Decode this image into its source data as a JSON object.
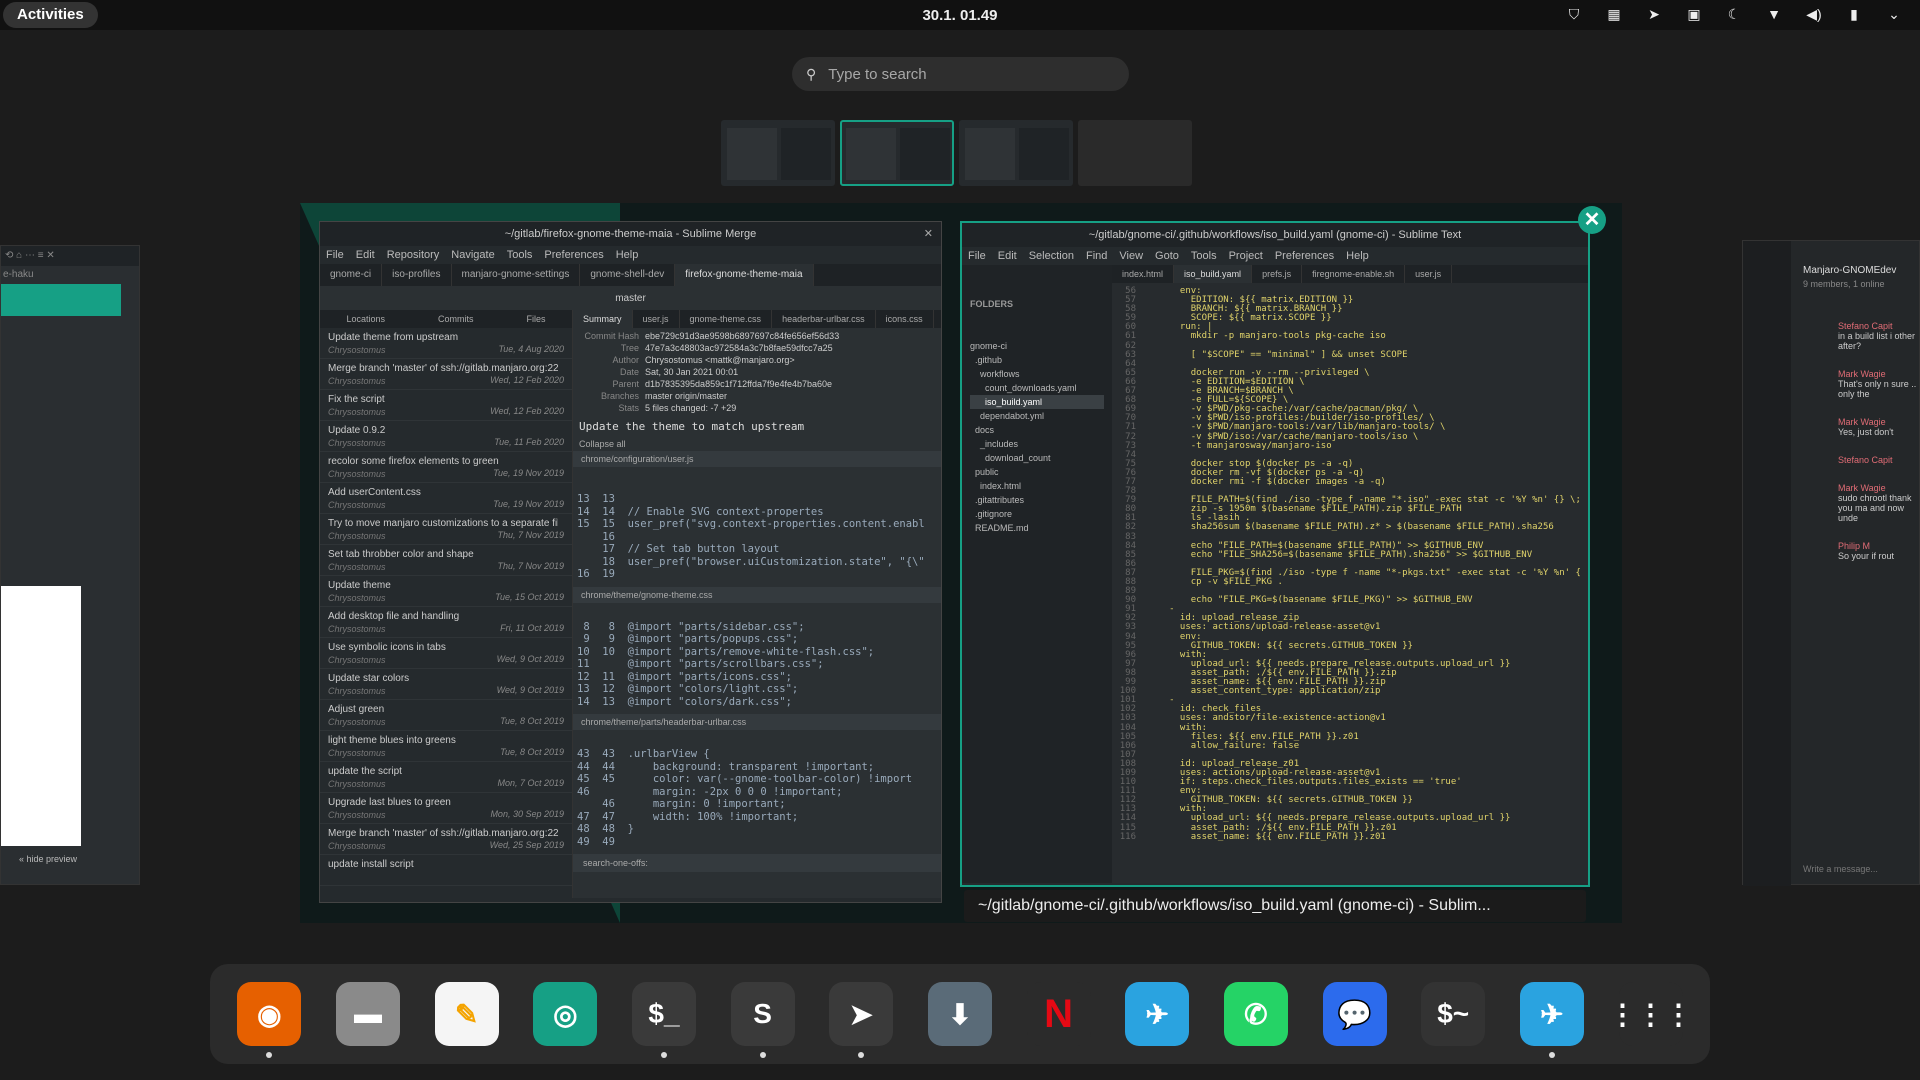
{
  "topbar": {
    "activities": "Activities",
    "clock": "30.1.  01.49"
  },
  "search": {
    "placeholder": "Type to search"
  },
  "merge": {
    "title": "~/gitlab/firefox-gnome-theme-maia - Sublime Merge",
    "menu": [
      "File",
      "Edit",
      "Repository",
      "Navigate",
      "Tools",
      "Preferences",
      "Help"
    ],
    "tabs": [
      "gnome-ci",
      "iso-profiles",
      "manjaro-gnome-settings",
      "gnome-shell-dev",
      "firefox-gnome-theme-maia"
    ],
    "branch": "master",
    "sidetabs": [
      "Locations",
      "Commits",
      "Files"
    ],
    "commits": [
      {
        "s": "Update theme from upstream",
        "a": "Chrysostomus",
        "d": "Tue, 4 Aug 2020"
      },
      {
        "s": "Merge branch 'master' of ssh://gitlab.manjaro.org:22277/",
        "a": "Chrysostomus",
        "d": "Wed, 12 Feb 2020"
      },
      {
        "s": "Fix the script",
        "a": "Chrysostomus",
        "d": "Wed, 12 Feb 2020"
      },
      {
        "s": "Update 0.9.2",
        "a": "Chrysostomus",
        "d": "Tue, 11 Feb 2020"
      },
      {
        "s": "recolor some firefox elements to green",
        "a": "Chrysostomus",
        "d": "Tue, 19 Nov 2019"
      },
      {
        "s": "Add userContent.css",
        "a": "Chrysostomus",
        "d": "Tue, 19 Nov 2019"
      },
      {
        "s": "Try to move manjaro customizations to a separate file",
        "a": "Chrysostomus",
        "d": "Thu, 7 Nov 2019"
      },
      {
        "s": "Set tab throbber color and shape",
        "a": "Chrysostomus",
        "d": "Thu, 7 Nov 2019"
      },
      {
        "s": "Update theme",
        "a": "Chrysostomus",
        "d": "Tue, 15 Oct 2019"
      },
      {
        "s": "Add desktop file and handling",
        "a": "Chrysostomus",
        "d": "Fri, 11 Oct 2019"
      },
      {
        "s": "Use symbolic icons in tabs",
        "a": "Chrysostomus",
        "d": "Wed, 9 Oct 2019"
      },
      {
        "s": "Update star colors",
        "a": "Chrysostomus",
        "d": "Wed, 9 Oct 2019"
      },
      {
        "s": "Adjust green",
        "a": "Chrysostomus",
        "d": "Tue, 8 Oct 2019"
      },
      {
        "s": "light theme blues into greens",
        "a": "Chrysostomus",
        "d": "Tue, 8 Oct 2019"
      },
      {
        "s": "update the script",
        "a": "Chrysostomus",
        "d": "Mon, 7 Oct 2019"
      },
      {
        "s": "Upgrade last blues to green",
        "a": "Chrysostomus",
        "d": "Mon, 30 Sep 2019"
      },
      {
        "s": "Merge branch 'master' of ssh://gitlab.manjaro.org:22277/",
        "a": "Chrysostomus",
        "d": "Wed, 25 Sep 2019"
      },
      {
        "s": "update install script",
        "a": "",
        "d": ""
      }
    ],
    "difftabs": [
      "Summary",
      "user.js",
      "gnome-theme.css",
      "headerbar-urlbar.css",
      "icons.css"
    ],
    "meta": [
      [
        "Commit Hash",
        "ebe729c91d3ae9598b6897697c84fe656ef56d33"
      ],
      [
        "Tree",
        "47e7a3c48803ac972584a3c7b8fae59dfcc7a25"
      ],
      [
        "Author",
        "Chrysostomus <mattk@manjaro.org>"
      ],
      [
        "Date",
        "Sat, 30 Jan 2021 00:01"
      ],
      [
        "Parent",
        "d1b7835395da859c1f712ffda7f9e4fe4b7ba60e"
      ],
      [
        "Branches",
        "master  origin/master"
      ],
      [
        "Stats",
        "5 files changed: -7 +29"
      ]
    ],
    "message": "Update the theme to match upstream",
    "collapse": "Collapse all",
    "file1": "chrome/configuration/user.js",
    "diff1": "13  13\n14  14  // Enable SVG context-propertes\n15  15  user_pref(\"svg.context-properties.content.enabl\n    16\n    17  // Set tab button layout\n    18  user_pref(\"browser.uiCustomization.state\", \"{\\\"\n16  19",
    "file2": "chrome/theme/gnome-theme.css",
    "diff2": " 8   8  @import \"parts/sidebar.css\";\n 9   9  @import \"parts/popups.css\";\n10  10  @import \"parts/remove-white-flash.css\";\n11      @import \"parts/scrollbars.css\";\n12  11  @import \"parts/icons.css\";\n13  12  @import \"colors/light.css\";\n14  13  @import \"colors/dark.css\";",
    "file3": "chrome/theme/parts/headerbar-urlbar.css",
    "diff3": "43  43  .urlbarView {\n44  44      background: transparent !important;\n45  45      color: var(--gnome-toolbar-color) !import\n46          margin: -2px 0 0 0 !important;\n    46      margin: 0 !important;\n47  47      width: 100% !important;\n48  48  }\n49  49",
    "footer": "search-one-offs:"
  },
  "sublime": {
    "title": "~/gitlab/gnome-ci/.github/workflows/iso_build.yaml (gnome-ci) - Sublime Text",
    "menu": [
      "File",
      "Edit",
      "Selection",
      "Find",
      "View",
      "Goto",
      "Tools",
      "Project",
      "Preferences",
      "Help"
    ],
    "tabs": [
      "index.html",
      "iso_build.yaml",
      "prefs.js",
      "firegnome-enable.sh",
      "user.js"
    ],
    "folders": "FOLDERS",
    "tree": [
      "gnome-ci",
      "  .github",
      "    workflows",
      "      count_downloads.yaml",
      "      iso_build.yaml",
      "    dependabot.yml",
      "  docs",
      "    _includes",
      "      download_count",
      "  public",
      "    index.html",
      "  .gitattributes",
      "  .gitignore",
      "  README.md"
    ],
    "code": "       env:\n         EDITION: ${{ matrix.EDITION }}\n         BRANCH: ${{ matrix.BRANCH }}\n         SCOPE: ${{ matrix.SCOPE }}\n       run: |\n         mkdir -p manjaro-tools pkg-cache iso\n\n         [ \"$SCOPE\" == \"minimal\" ] && unset SCOPE\n\n         docker run -v --rm --privileged \\\n         -e EDITION=$EDITION \\\n         -e BRANCH=$BRANCH \\\n         -e FULL=${SCOPE} \\\n         -v $PWD/pkg-cache:/var/cache/pacman/pkg/ \\\n         -v $PWD/iso-profiles:/builder/iso-profiles/ \\\n         -v $PWD/manjaro-tools:/var/lib/manjaro-tools/ \\\n         -v $PWD/iso:/var/cache/manjaro-tools/iso \\\n         -t manjarosway/manjaro-iso\n\n         docker stop $(docker ps -a -q)\n         docker rm -vf $(docker ps -a -q)\n         docker rmi -f $(docker images -a -q)\n\n         FILE_PATH=$(find ./iso -type f -name \"*.iso\" -exec stat -c '%Y %n' {} \\;\n         zip -s 1950m $(basename $FILE_PATH).zip $FILE_PATH\n         ls -lasih .\n         sha256sum $(basename $FILE_PATH).z* > $(basename $FILE_PATH).sha256\n\n         echo \"FILE_PATH=$(basename $FILE_PATH)\" >> $GITHUB_ENV\n         echo \"FILE_SHA256=$(basename $FILE_PATH).sha256\" >> $GITHUB_ENV\n\n         FILE_PKG=$(find ./iso -type f -name \"*-pkgs.txt\" -exec stat -c '%Y %n' {\n         cp -v $FILE_PKG .\n\n         echo \"FILE_PKG=$(basename $FILE_PKG)\" >> $GITHUB_ENV\n     -\n       id: upload_release_zip\n       uses: actions/upload-release-asset@v1\n       env:\n         GITHUB_TOKEN: ${{ secrets.GITHUB_TOKEN }}\n       with:\n         upload_url: ${{ needs.prepare_release.outputs.upload_url }}\n         asset_path: ./${{ env.FILE_PATH }}.zip\n         asset_name: ${{ env.FILE_PATH }}.zip\n         asset_content_type: application/zip\n     -\n       id: check_files\n       uses: andstor/file-existence-action@v1\n       with:\n         files: ${{ env.FILE_PATH }}.z01\n         allow_failure: false\n\n       id: upload_release_z01\n       uses: actions/upload-release-asset@v1\n       if: steps.check_files.outputs.files_exists == 'true'\n       env:\n         GITHUB_TOKEN: ${{ secrets.GITHUB_TOKEN }}\n       with:\n         upload_url: ${{ needs.prepare_release.outputs.upload_url }}\n         asset_path: ./${{ env.FILE_PATH }}.z01\n         asset_name: ${{ env.FILE_PATH }}.z01",
    "first_line": 56
  },
  "caption": "~/gitlab/gnome-ci/.github/workflows/iso_build.yaml (gnome-ci) - Sublim...",
  "left_win": {
    "tab": "e-haku",
    "hide_preview": "« hide preview"
  },
  "chat": {
    "title": "Manjaro-GNOMEdev",
    "sub": "9 members, 1 online",
    "msgs": [
      {
        "n": "Stefano Capit",
        "t": "in a build list i other after?"
      },
      {
        "n": "Mark Wagie",
        "t": "That's only n sure .. only the"
      },
      {
        "n": "Mark Wagie",
        "t": "Yes, just don't"
      },
      {
        "n": "Stefano Capit",
        "t": ""
      },
      {
        "n": "Mark Wagie",
        "t": "sudo chrootl thank you ma and now unde"
      },
      {
        "n": "Philip M",
        "t": "So your if rout"
      }
    ],
    "input": "Write a message..."
  },
  "dock": [
    {
      "name": "firefox",
      "color": "#e66000",
      "glyph": "◉",
      "running": true
    },
    {
      "name": "files",
      "color": "#8a8a8a",
      "glyph": "▬",
      "running": false
    },
    {
      "name": "text-editor",
      "color": "#f5f5f5",
      "glyph": "✎",
      "running": false
    },
    {
      "name": "shutter",
      "color": "#16a085",
      "glyph": "◎",
      "running": false
    },
    {
      "name": "terminal",
      "color": "#3a3a3a",
      "glyph": "$_",
      "running": true
    },
    {
      "name": "sublime-text",
      "color": "#3a3a3a",
      "glyph": "S",
      "running": true
    },
    {
      "name": "sublime-merge",
      "color": "#3a3a3a",
      "glyph": "➤",
      "running": true
    },
    {
      "name": "downloader",
      "color": "#5a6b78",
      "glyph": "⬇",
      "running": false
    },
    {
      "name": "netflix",
      "color": "#2b2b2b",
      "glyph": "N",
      "running": false
    },
    {
      "name": "telegram",
      "color": "#2aa3e0",
      "glyph": "✈",
      "running": false
    },
    {
      "name": "whatsapp",
      "color": "#25d366",
      "glyph": "✆",
      "running": false
    },
    {
      "name": "signal",
      "color": "#2c6bed",
      "glyph": "💬",
      "running": false
    },
    {
      "name": "terminal-2",
      "color": "#333",
      "glyph": "$~",
      "running": false
    },
    {
      "name": "telegram-2",
      "color": "#2aa3e0",
      "glyph": "✈",
      "running": true
    },
    {
      "name": "app-grid",
      "color": "#2b2b2b",
      "glyph": "⋮⋮⋮",
      "running": false
    }
  ],
  "colors": {
    "accent": "#16a085",
    "panel": "#111111"
  }
}
